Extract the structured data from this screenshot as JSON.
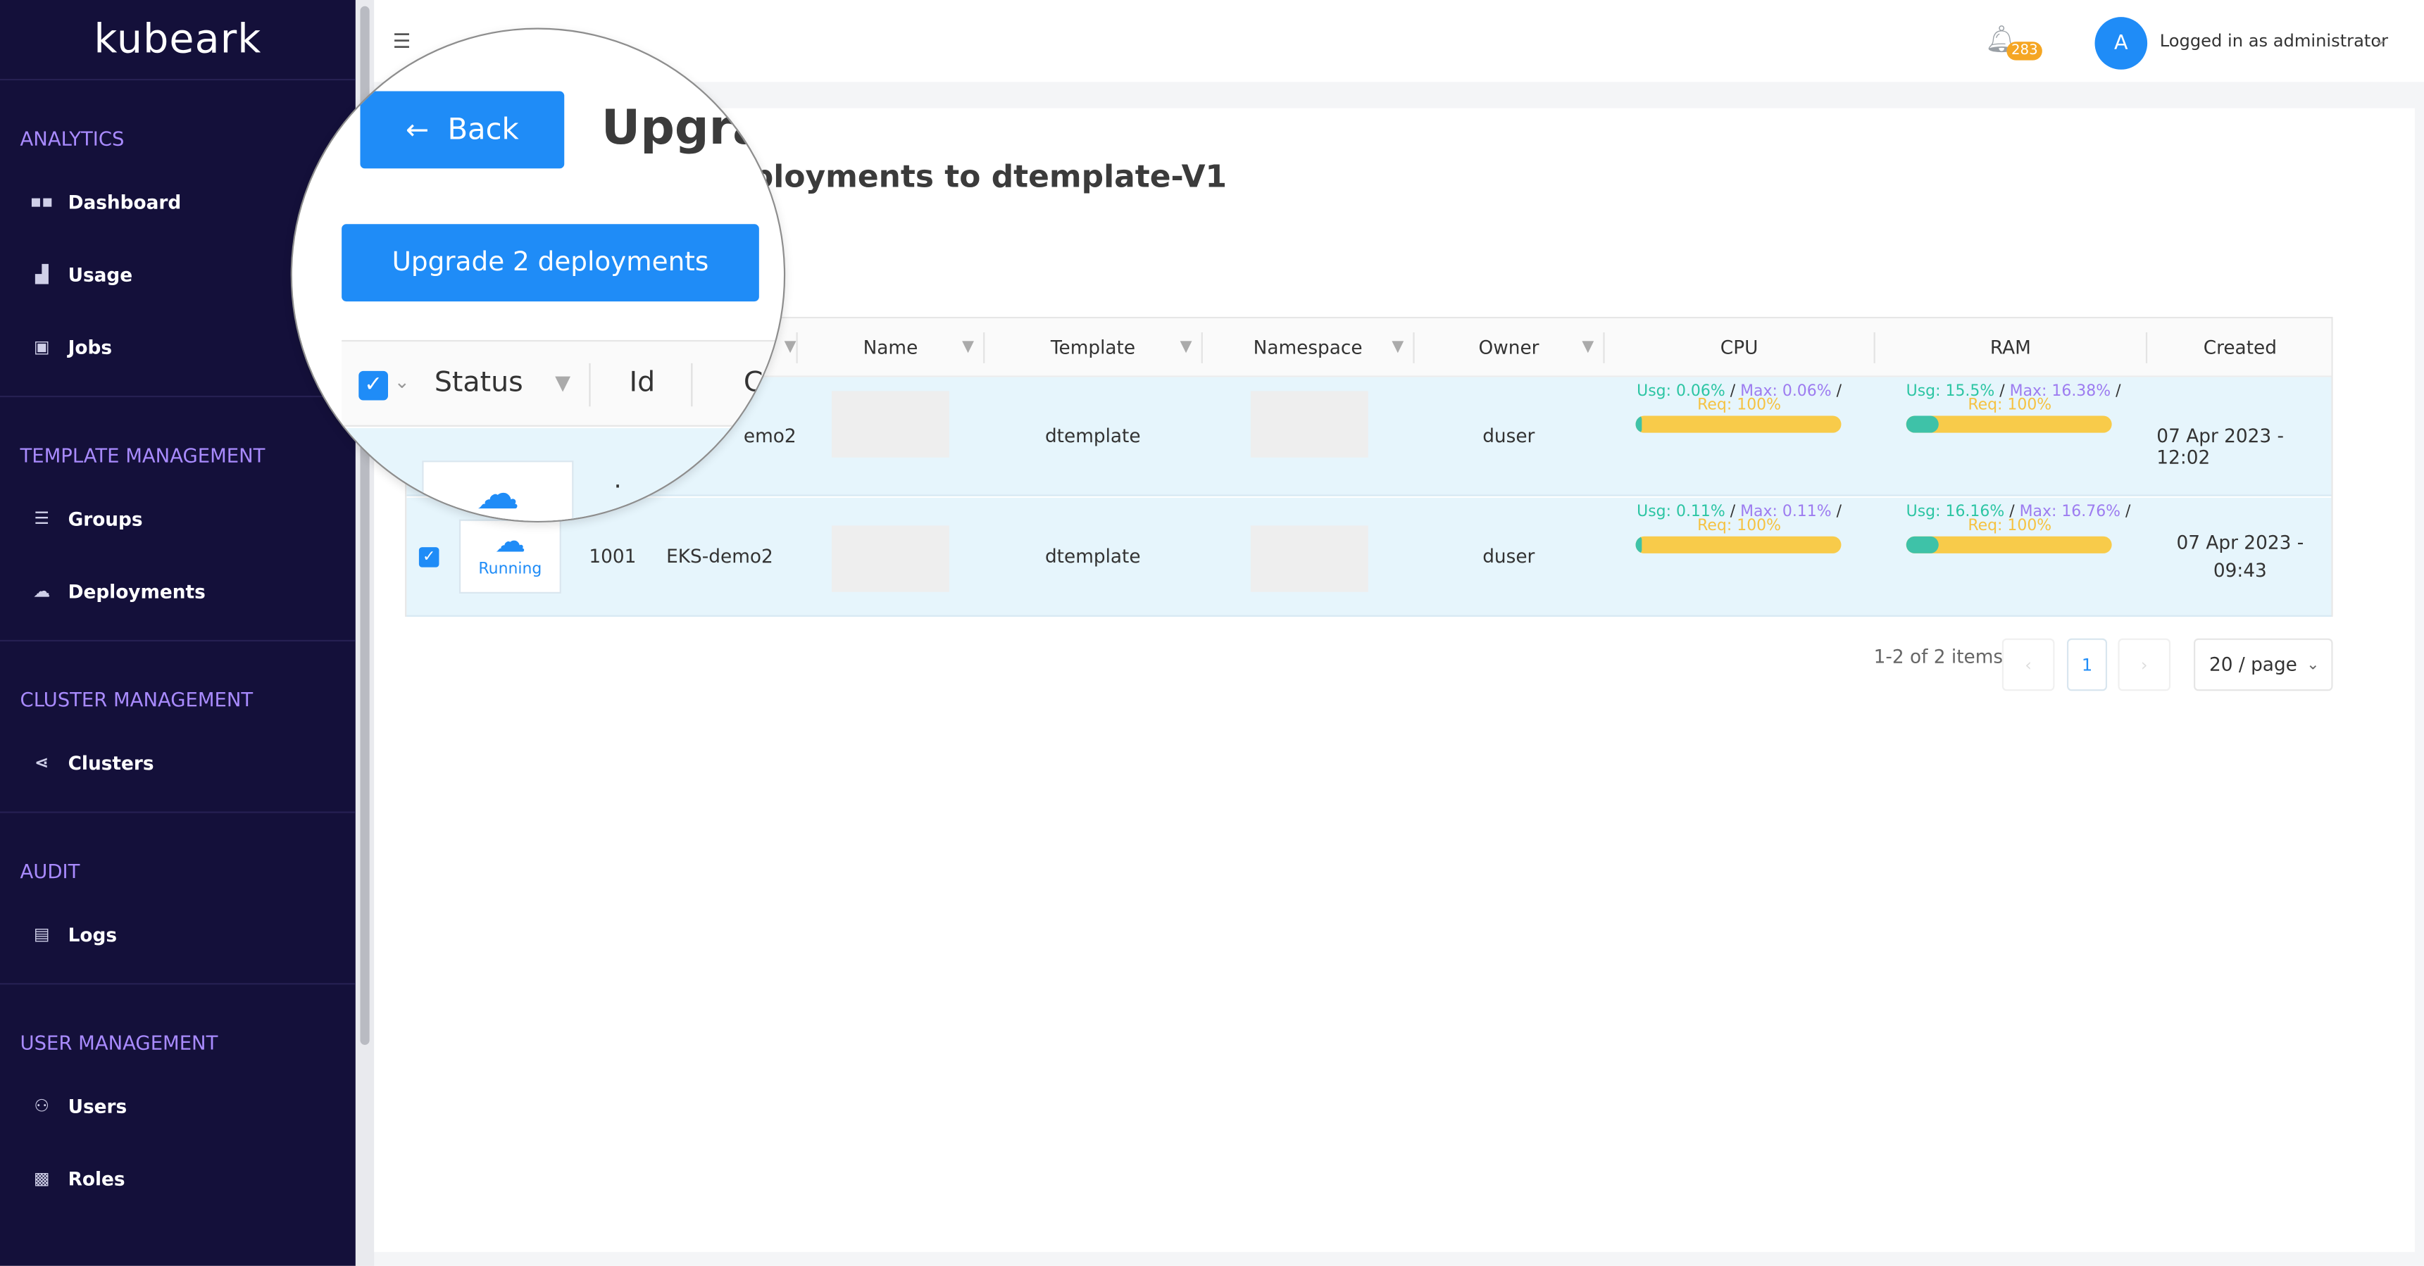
{
  "app": {
    "logo": "kubeark"
  },
  "sidebar": {
    "sections": [
      {
        "title": "ANALYTICS",
        "items": [
          {
            "label": "Dashboard",
            "icon": "dashboard-icon"
          },
          {
            "label": "Usage",
            "icon": "chart-icon"
          },
          {
            "label": "Jobs",
            "icon": "jobs-icon"
          }
        ]
      },
      {
        "title": "TEMPLATE MANAGEMENT",
        "items": [
          {
            "label": "Groups",
            "icon": "groups-icon"
          },
          {
            "label": "Deployments",
            "icon": "cloud-icon"
          }
        ]
      },
      {
        "title": "CLUSTER MANAGEMENT",
        "items": [
          {
            "label": "Clusters",
            "icon": "share-icon"
          }
        ]
      },
      {
        "title": "AUDIT",
        "items": [
          {
            "label": "Logs",
            "icon": "clipboard-icon"
          }
        ]
      },
      {
        "title": "USER MANAGEMENT",
        "items": [
          {
            "label": "Users",
            "icon": "users-icon"
          },
          {
            "label": "Roles",
            "icon": "roles-icon"
          }
        ]
      }
    ]
  },
  "header": {
    "notification_count": "283",
    "avatar_initial": "A",
    "user_label": "Logged in as administrator"
  },
  "page": {
    "back_label": "Back",
    "title_partial": "Upgra",
    "subtitle_partial": "ployments to dtemplate-V1",
    "upgrade_button": "Upgrade 2 deployments"
  },
  "table": {
    "columns": {
      "status": "Status",
      "id": "Id",
      "c": "C",
      "name": "Name",
      "template": "Template",
      "namespace": "Namespace",
      "owner": "Owner",
      "cpu": "CPU",
      "ram": "RAM",
      "created": "Created"
    },
    "rows": [
      {
        "status": "",
        "id": "",
        "cluster": "emo2",
        "template": "dtemplate",
        "owner": "duser",
        "cpu": {
          "usg": "Usg: 0.06%",
          "max": "Max: 0.06%",
          "req": "Req: 100%",
          "usage_fraction": 0.0006
        },
        "ram": {
          "usg": "Usg: 15.5%",
          "max": "Max: 16.38%",
          "req": "Req: 100%",
          "usage_fraction": 0.155
        },
        "created": "07 Apr 2023 - 12:02"
      },
      {
        "status": "Running",
        "id": "1001",
        "cluster": "EKS-demo2",
        "template": "dtemplate",
        "owner": "duser",
        "cpu": {
          "usg": "Usg: 0.11%",
          "max": "Max: 0.11%",
          "req": "Req: 100%",
          "usage_fraction": 0.0011
        },
        "ram": {
          "usg": "Usg: 16.16%",
          "max": "Max: 16.76%",
          "req": "Req: 100%",
          "usage_fraction": 0.1616
        },
        "created_line1": "07 Apr 2023 -",
        "created_line2": "09:43"
      }
    ]
  },
  "pagination": {
    "summary": "1-2 of 2 items",
    "current_page": "1",
    "page_size": "20 / page"
  },
  "colors": {
    "sidebar_bg": "#14103a",
    "accent": "#1f8cf7",
    "section_title": "#a98bff",
    "usage": "#2cc5a3",
    "max": "#9d7cf0",
    "req": "#f5c242",
    "row_selected": "#e6f5fc"
  }
}
